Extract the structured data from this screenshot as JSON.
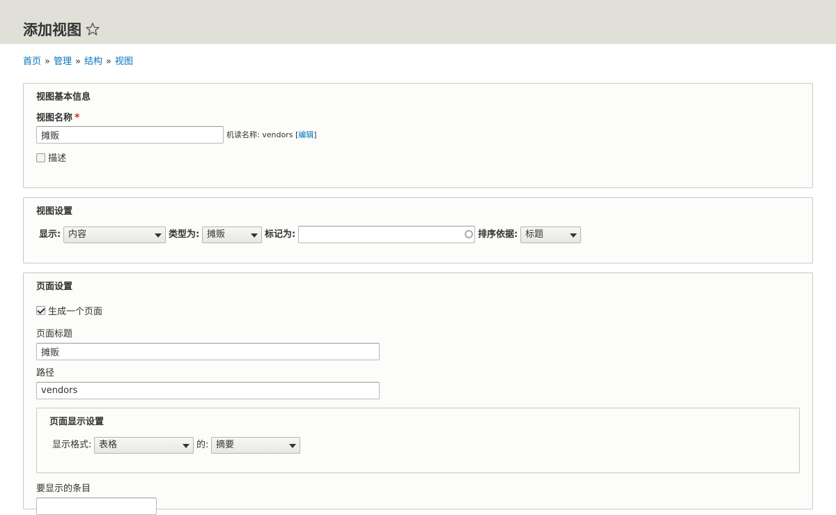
{
  "header": {
    "title": "添加视图"
  },
  "breadcrumb": [
    {
      "label": "首页"
    },
    {
      "label": "管理"
    },
    {
      "label": "结构"
    },
    {
      "label": "视图"
    }
  ],
  "breadcrumb_separator": "»",
  "basic_info": {
    "legend": "视图基本信息",
    "name_label": "视图名称",
    "required_mark": "*",
    "name_value": "摊贩",
    "machine_name_prefix": "机读名称:",
    "machine_name_value": "vendors",
    "machine_name_edit": "编辑",
    "bracket_open": "[",
    "bracket_close": "]",
    "description_label": "描述"
  },
  "view_settings": {
    "legend": "视图设置",
    "show_label": "显示:",
    "show_value": "内容",
    "type_label": "类型为:",
    "type_value": "摊贩",
    "tagged_label": "标记为:",
    "tagged_value": "",
    "sort_label": "排序依据:",
    "sort_value": "标题"
  },
  "page_settings": {
    "legend": "页面设置",
    "create_page_label": "生成一个页面",
    "create_page_checked": true,
    "page_title_label": "页面标题",
    "page_title_value": "摊贩",
    "path_label": "路径",
    "path_value": "vendors",
    "display_settings": {
      "legend": "页面显示设置",
      "format_label": "显示格式:",
      "format_value": "表格",
      "of_label": "的:",
      "of_value": "摘要"
    },
    "items_label": "要显示的条目"
  },
  "colors": {
    "header_bg": "#e0e0d8",
    "link": "#0074bd",
    "required": "#e32700"
  }
}
